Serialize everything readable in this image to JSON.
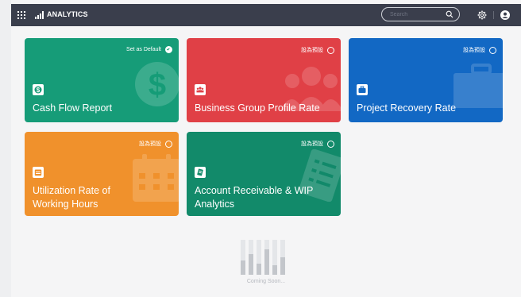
{
  "app": {
    "title": "ANALYTICS"
  },
  "search": {
    "placeholder": "Search"
  },
  "colors": {
    "topbar": "#3a3e4c",
    "card_green": "#169c78",
    "card_red": "#e04046",
    "card_blue": "#1268c4",
    "card_orange": "#f0912c",
    "card_darkgreen": "#128a6a"
  },
  "cards": [
    {
      "title": "Cash Flow Report",
      "default_label": "Set as Default",
      "is_default": true,
      "icon": "dollar-icon",
      "color": "#169c78"
    },
    {
      "title": "Business Group Profile Rate",
      "default_label": "設為預設",
      "is_default": false,
      "icon": "group-icon",
      "color": "#e04046"
    },
    {
      "title": "Project Recovery Rate",
      "default_label": "設為預設",
      "is_default": false,
      "icon": "briefcase-icon",
      "color": "#1268c4"
    },
    {
      "title_line1": "Utilization Rate of",
      "title_line2": "Working Hours",
      "default_label": "設為預設",
      "is_default": false,
      "icon": "calendar-icon",
      "color": "#f0912c"
    },
    {
      "title_line1": "Account Receivable & WIP",
      "title_line2": "Analytics",
      "default_label": "設為預設",
      "is_default": false,
      "icon": "receipt-icon",
      "color": "#128a6a"
    }
  ],
  "coming_soon": {
    "label": "Coming Soon..."
  }
}
